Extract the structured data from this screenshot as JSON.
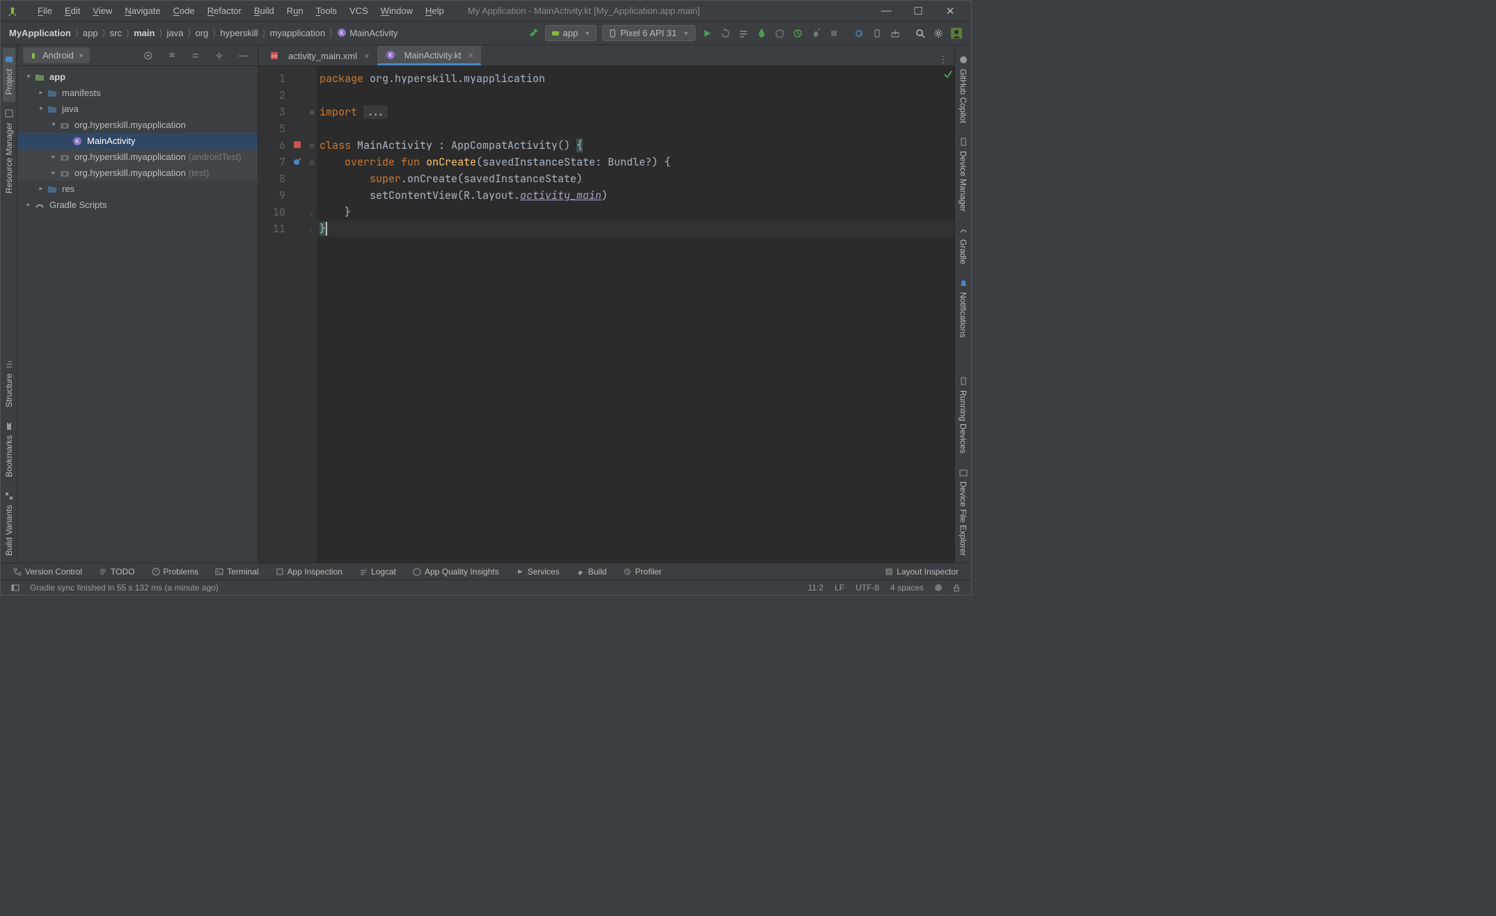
{
  "window": {
    "title": "My Application - MainActivity.kt [My_Application.app.main]"
  },
  "menu": {
    "file": "File",
    "edit": "Edit",
    "view": "View",
    "navigate": "Navigate",
    "code": "Code",
    "refactor": "Refactor",
    "build": "Build",
    "run": "Run",
    "tools": "Tools",
    "vcs": "VCS",
    "window": "Window",
    "help": "Help"
  },
  "breadcrumb": {
    "items": [
      "MyApplication",
      "app",
      "src",
      "main",
      "java",
      "org",
      "hyperskill",
      "myapplication",
      "MainActivity"
    ],
    "bold": [
      0,
      3
    ]
  },
  "toolbar": {
    "run_config": "app",
    "device": "Pixel 6 API 31"
  },
  "left_rail": [
    "Project",
    "Resource Manager",
    "Structure",
    "Bookmarks",
    "Build Variants"
  ],
  "right_rail": [
    "GitHub Copilot",
    "Device Manager",
    "Gradle",
    "Notifications",
    "Running Devices",
    "Device File Explorer"
  ],
  "sidebar": {
    "view": "Android",
    "tree": [
      {
        "depth": 0,
        "arrow": "down",
        "icon": "module",
        "label": "app",
        "bold": true
      },
      {
        "depth": 1,
        "arrow": "right",
        "icon": "folder",
        "label": "manifests"
      },
      {
        "depth": 1,
        "arrow": "down",
        "icon": "folder",
        "label": "java"
      },
      {
        "depth": 2,
        "arrow": "down",
        "icon": "pkg",
        "label": "org.hyperskill.myapplication"
      },
      {
        "depth": 3,
        "arrow": "",
        "icon": "kt",
        "label": "MainActivity",
        "selected": true
      },
      {
        "depth": 2,
        "arrow": "right",
        "icon": "pkg",
        "label": "org.hyperskill.myapplication",
        "suffix": "(androidTest)",
        "shade": true
      },
      {
        "depth": 2,
        "arrow": "right",
        "icon": "pkg",
        "label": "org.hyperskill.myapplication",
        "suffix": "(test)",
        "shade": true
      },
      {
        "depth": 1,
        "arrow": "right",
        "icon": "folder",
        "label": "res"
      },
      {
        "depth": 0,
        "arrow": "right",
        "icon": "gradle",
        "label": "Gradle Scripts"
      }
    ]
  },
  "editor_tabs": [
    {
      "icon": "xml",
      "label": "activity_main.xml",
      "active": false
    },
    {
      "icon": "kt",
      "label": "MainActivity.kt",
      "active": true
    }
  ],
  "code": {
    "lines": [
      {
        "n": 1,
        "html": "<span class='kw'>package</span> org.hyperskill.myapplication"
      },
      {
        "n": 2,
        "html": ""
      },
      {
        "n": 3,
        "html": "<span class='kw'>import</span> <span class='folded'>...</span>",
        "fold": "plus"
      },
      {
        "n": 5,
        "html": ""
      },
      {
        "n": 6,
        "html": "<span class='kw'>class</span> MainActivity : AppCompatActivity() <span class='bold-y'>{</span>",
        "fold": "minus",
        "gicon": "layout"
      },
      {
        "n": 7,
        "html": "    <span class='kw'>override</span> <span class='kw'>fun</span> <span class='fn'>onCreate</span>(savedInstanceState: Bundle?) {",
        "fold": "minus",
        "gicon": "override"
      },
      {
        "n": 8,
        "html": "        <span class='kw'>super</span>.onCreate(savedInstanceState)"
      },
      {
        "n": 9,
        "html": "        setContentView(R.layout.<span class='it'>activity_main</span>)"
      },
      {
        "n": 10,
        "html": "    }",
        "fold": "end"
      },
      {
        "n": 11,
        "html": "<span class='bold-y'>}</span><span class='caret'></span>",
        "fold": "end",
        "hl": true
      }
    ]
  },
  "bottom_tabs": [
    "Version Control",
    "TODO",
    "Problems",
    "Terminal",
    "App Inspection",
    "Logcat",
    "App Quality Insights",
    "Services",
    "Build",
    "Profiler"
  ],
  "bottom_right": "Layout Inspector",
  "status": {
    "msg": "Gradle sync finished in 55 s 132 ms (a minute ago)",
    "pos": "11:2",
    "line_sep": "LF",
    "encoding": "UTF-8",
    "indent": "4 spaces"
  }
}
